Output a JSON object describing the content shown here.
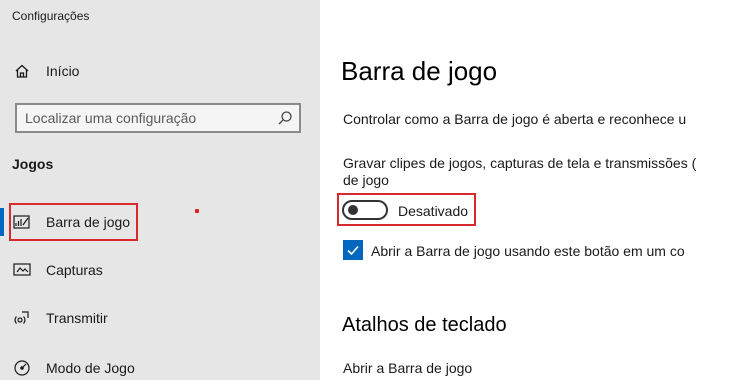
{
  "window": {
    "title": "Configurações"
  },
  "sidebar": {
    "home_label": "Início",
    "search_placeholder": "Localizar uma configuração",
    "section_title": "Jogos",
    "items": [
      {
        "label": "Barra de jogo",
        "icon": "game-bar-icon",
        "active": true
      },
      {
        "label": "Capturas",
        "icon": "captures-icon",
        "active": false
      },
      {
        "label": "Transmitir",
        "icon": "broadcast-icon",
        "active": false
      },
      {
        "label": "Modo de Jogo",
        "icon": "game-mode-icon",
        "active": false
      }
    ]
  },
  "main": {
    "title": "Barra de jogo",
    "description": "Controlar como a Barra de jogo é aberta e reconhece u",
    "record_setting": {
      "label_line1": "Gravar clipes de jogos, capturas de tela e transmissões (",
      "label_line2": "de jogo",
      "toggle_state": "Desativado",
      "toggle_on": false
    },
    "checkbox": {
      "label": "Abrir a Barra de jogo usando este botão em um co",
      "checked": true
    },
    "shortcuts_title": "Atalhos de teclado",
    "shortcut_item_label": "Abrir a Barra de jogo"
  },
  "colors": {
    "accent": "#0067c0",
    "highlight": "#d9292b",
    "sidebar_bg": "#e6e6e6"
  }
}
